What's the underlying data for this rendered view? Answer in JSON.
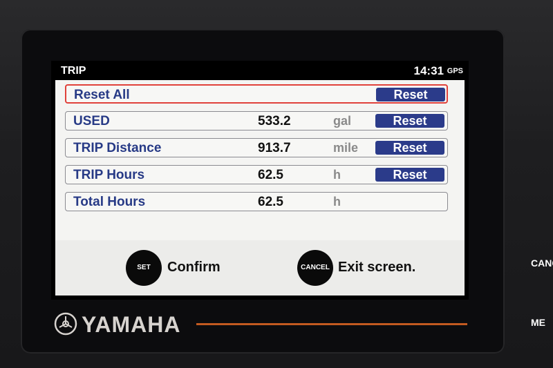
{
  "header": {
    "title": "TRIP",
    "time": "14:31",
    "gps_label": "GPS"
  },
  "rows": [
    {
      "label": "Reset All",
      "value": "",
      "unit": "",
      "button": "Reset",
      "selected": true
    },
    {
      "label": "USED",
      "value": "533.2",
      "unit": "gal",
      "button": "Reset"
    },
    {
      "label": "TRIP Distance",
      "value": "913.7",
      "unit": "mile",
      "button": "Reset"
    },
    {
      "label": "TRIP Hours",
      "value": "62.5",
      "unit": "h",
      "button": "Reset"
    },
    {
      "label": "Total Hours",
      "value": "62.5",
      "unit": "h",
      "button": ""
    }
  ],
  "footer": {
    "set_button": "SET",
    "set_action": "Confirm",
    "cancel_button": "CANCEL",
    "cancel_action": "Exit screen."
  },
  "brand": {
    "name": "YAMAHA",
    "accent_color": "#c35a20"
  },
  "side_buttons": {
    "cancel": "CANC",
    "menu": "ME"
  },
  "colors": {
    "label_blue": "#273a86",
    "button_blue": "#2b3b8a",
    "selection_red": "#e0403a"
  }
}
